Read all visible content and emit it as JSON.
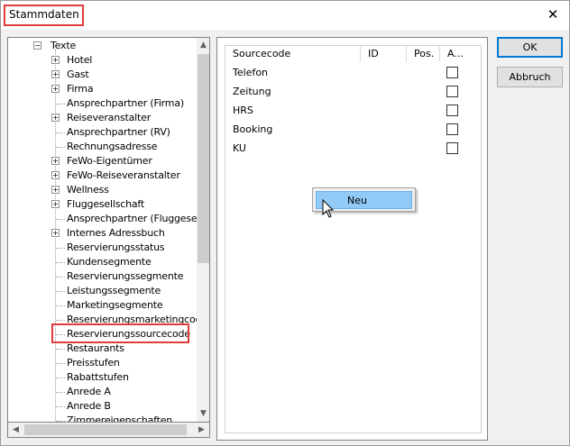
{
  "window": {
    "title": "Stammdaten",
    "close_symbol": "✕"
  },
  "tree": {
    "root_label": "Texte",
    "items": [
      {
        "label": "Hotel",
        "expandable": true
      },
      {
        "label": "Gast",
        "expandable": true
      },
      {
        "label": "Firma",
        "expandable": true
      },
      {
        "label": "Ansprechpartner (Firma)",
        "expandable": false
      },
      {
        "label": "Reiseveranstalter",
        "expandable": true
      },
      {
        "label": "Ansprechpartner (RV)",
        "expandable": false
      },
      {
        "label": "Rechnungsadresse",
        "expandable": false
      },
      {
        "label": "FeWo-Eigentümer",
        "expandable": true
      },
      {
        "label": "FeWo-Reiseveranstalter",
        "expandable": true
      },
      {
        "label": "Wellness",
        "expandable": true
      },
      {
        "label": "Fluggesellschaft",
        "expandable": true
      },
      {
        "label": "Ansprechpartner (Fluggesellsc",
        "expandable": false
      },
      {
        "label": "Internes Adressbuch",
        "expandable": true
      },
      {
        "label": "Reservierungsstatus",
        "expandable": false
      },
      {
        "label": "Kundensegmente",
        "expandable": false
      },
      {
        "label": "Reservierungssegmente",
        "expandable": false
      },
      {
        "label": "Leistungssegmente",
        "expandable": false
      },
      {
        "label": "Marketingsegmente",
        "expandable": false
      },
      {
        "label": "Reservierungsmarketingcode",
        "expandable": false
      },
      {
        "label": "Reservierungssourcecode",
        "expandable": false,
        "selected": true
      },
      {
        "label": "Restaurants",
        "expandable": false
      },
      {
        "label": "Preisstufen",
        "expandable": false
      },
      {
        "label": "Rabattstufen",
        "expandable": false
      },
      {
        "label": "Anrede A",
        "expandable": false
      },
      {
        "label": "Anrede B",
        "expandable": false
      },
      {
        "label": "Zimmereigenschaften",
        "expandable": false
      }
    ]
  },
  "list": {
    "columns": [
      "Sourcecode",
      "ID",
      "Pos.",
      "A..."
    ],
    "rows": [
      {
        "label": "Telefon",
        "checked": false
      },
      {
        "label": "Zeitung",
        "checked": false
      },
      {
        "label": "HRS",
        "checked": false
      },
      {
        "label": "Booking",
        "checked": false
      },
      {
        "label": "KU",
        "checked": false
      }
    ]
  },
  "context_menu": {
    "items": [
      "Neu"
    ]
  },
  "buttons": {
    "ok": "OK",
    "cancel": "Abbruch"
  },
  "colors": {
    "highlight_red": "#e03c3c",
    "menu_hover": "#91c9f7",
    "default_button_border": "#0078d7"
  }
}
